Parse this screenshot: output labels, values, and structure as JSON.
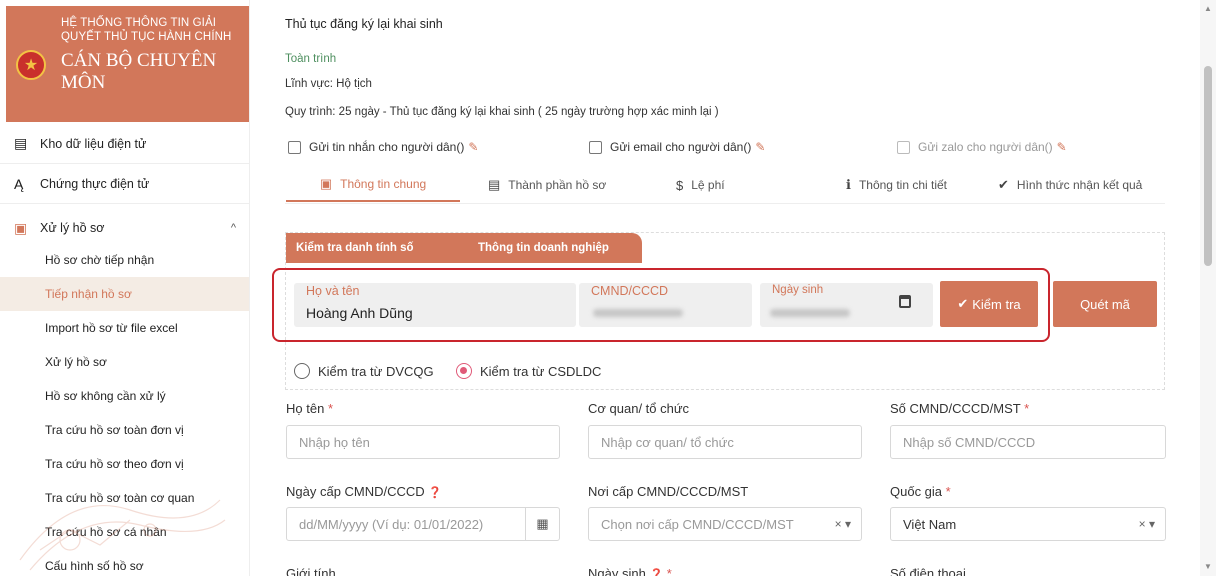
{
  "sidebar": {
    "system_name": "HỆ THỐNG THÔNG TIN GIẢI QUYẾT THỦ TỤC HÀNH CHÍNH",
    "role": "CÁN BỘ CHUYÊN MÔN",
    "main_items": [
      {
        "label": "Kho dữ liệu điện tử",
        "icon": "building-icon"
      },
      {
        "label": "Chứng thực điện tử",
        "icon": "signature-icon"
      },
      {
        "label": "Xử lý hồ sơ",
        "icon": "folder-icon",
        "expanded": true
      }
    ],
    "sub_items": [
      {
        "label": "Hồ sơ chờ tiếp nhận"
      },
      {
        "label": "Tiếp nhận hồ sơ",
        "active": true
      },
      {
        "label": "Import hồ sơ từ file excel"
      },
      {
        "label": "Xử lý hồ sơ"
      },
      {
        "label": "Hồ sơ không cần xử lý"
      },
      {
        "label": "Tra cứu hồ sơ toàn đơn vị"
      },
      {
        "label": "Tra cứu hồ sơ theo đơn vị"
      },
      {
        "label": "Tra cứu hồ sơ toàn cơ quan"
      },
      {
        "label": "Tra cứu hồ sơ cá nhân"
      },
      {
        "label": "Cấu hình số hồ sơ"
      }
    ]
  },
  "header": {
    "title": "Thủ tục đăng ký lại khai sinh",
    "subtitle": "Toàn trình",
    "field_line": "Lĩnh vực: Hộ tịch",
    "process_line": "Quy trình: 25 ngày - Thủ tục đăng ký lại khai sinh ( 25 ngày trường hợp xác minh lại )"
  },
  "notify": [
    {
      "label": "Gửi tin nhắn cho người dân()",
      "checked": false,
      "disabled": false
    },
    {
      "label": "Gửi email cho người dân()",
      "checked": false,
      "disabled": false
    },
    {
      "label": "Gửi zalo cho người dân()",
      "checked": false,
      "disabled": true
    }
  ],
  "tabs": [
    {
      "label": "Thông tin chung",
      "icon": "id-card-icon",
      "active": true
    },
    {
      "label": "Thành phần hồ sơ",
      "icon": "list-icon"
    },
    {
      "label": "Lệ phí",
      "icon": "dollar-icon"
    },
    {
      "label": "Thông tin chi tiết",
      "icon": "info-icon"
    },
    {
      "label": "Hình thức nhận kết quả",
      "icon": "badge-check-icon"
    }
  ],
  "lookup": {
    "tab_identity": "Kiểm tra danh tính số",
    "tab_business": "Thông tin doanh nghiệp",
    "name_label": "Họ và tên",
    "name_value": "Hoàng Anh Dũng",
    "id_label": "CMND/CCCD",
    "dob_label": "Ngày sinh",
    "check_button": "Kiểm tra",
    "scan_button": "Quét mã",
    "radio_dvcqg": "Kiểm tra từ DVCQG",
    "radio_csdldc": "Kiểm tra từ CSDLDC",
    "selected_source": "CSDLDC"
  },
  "form": {
    "ho_ten": {
      "label": "Họ tên",
      "required": "*",
      "placeholder": "Nhập họ tên"
    },
    "co_quan": {
      "label": "Cơ quan/ tổ chức",
      "placeholder": "Nhập cơ quan/ tổ chức"
    },
    "so_cmnd": {
      "label": "Số CMND/CCCD/MST",
      "required": "*",
      "placeholder": "Nhập số CMND/CCCD"
    },
    "ngay_cap": {
      "label": "Ngày cấp CMND/CCCD",
      "placeholder": "dd/MM/yyyy (Ví dụ: 01/01/2022)"
    },
    "noi_cap": {
      "label": "Nơi cấp CMND/CCCD/MST",
      "placeholder": "Chọn nơi cấp CMND/CCCD/MST"
    },
    "quoc_gia": {
      "label": "Quốc gia",
      "required": "*",
      "value": "Việt Nam"
    },
    "gioi_tinh": {
      "label": "Giới tính"
    },
    "ngay_sinh": {
      "label": "Ngày sinh",
      "required": "*"
    },
    "so_dien_thoai": {
      "label": "Số điện thoại"
    }
  },
  "colors": {
    "accent": "#d2775a",
    "highlight_frame": "#c9252d",
    "radio_selected": "#e05a78"
  }
}
